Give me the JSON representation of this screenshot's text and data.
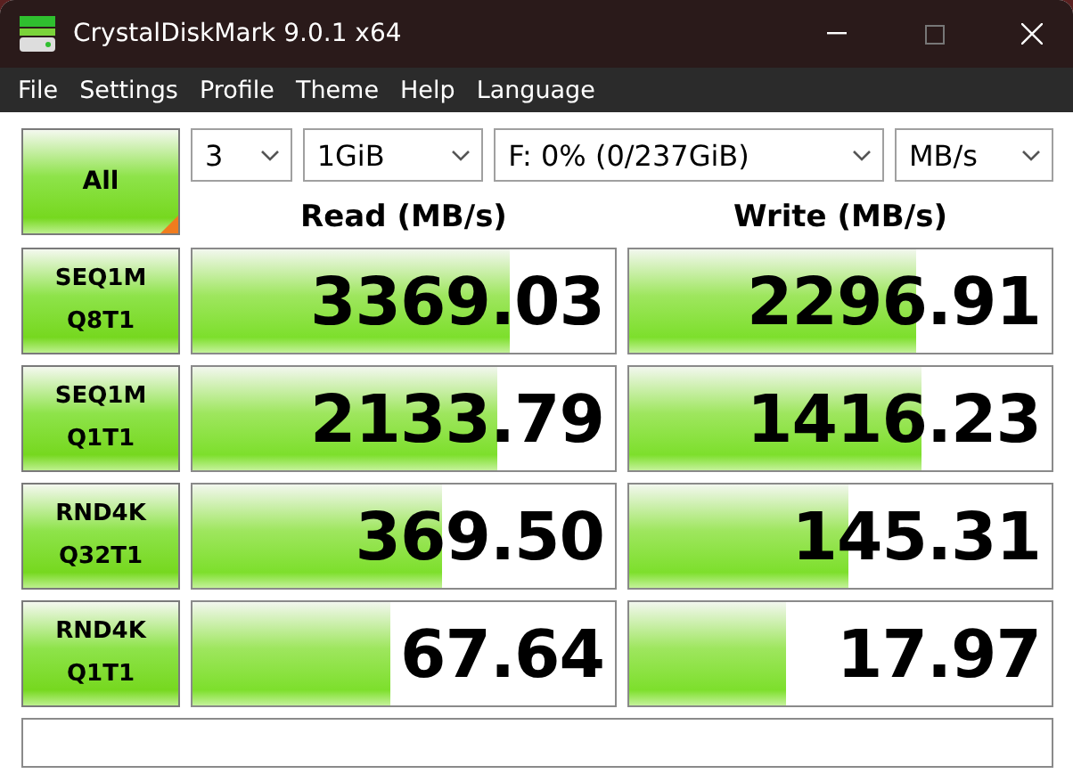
{
  "window": {
    "title": "CrystalDiskMark 9.0.1 x64"
  },
  "menu": [
    "File",
    "Settings",
    "Profile",
    "Theme",
    "Help",
    "Language"
  ],
  "all_button": {
    "label": "All"
  },
  "selectors": [
    {
      "value": "3"
    },
    {
      "value": "1GiB"
    },
    {
      "value": "F: 0% (0/237GiB)"
    },
    {
      "value": "MB/s"
    }
  ],
  "columns": [
    "Read (MB/s)",
    "Write (MB/s)"
  ],
  "rows": [
    {
      "test": [
        "SEQ1M",
        "Q8T1"
      ],
      "read": {
        "value": "3369.03",
        "level": 0.75
      },
      "write": {
        "value": "2296.91",
        "level": 0.68
      }
    },
    {
      "test": [
        "SEQ1M",
        "Q1T1"
      ],
      "read": {
        "value": "2133.79",
        "level": 0.72
      },
      "write": {
        "value": "1416.23",
        "level": 0.69
      }
    },
    {
      "test": [
        "RND4K",
        "Q32T1"
      ],
      "read": {
        "value": "369.50",
        "level": 0.59
      },
      "write": {
        "value": "145.31",
        "level": 0.52
      }
    },
    {
      "test": [
        "RND4K",
        "Q1T1"
      ],
      "read": {
        "value": "67.64",
        "level": 0.47
      },
      "write": {
        "value": "17.97",
        "level": 0.37
      }
    }
  ]
}
